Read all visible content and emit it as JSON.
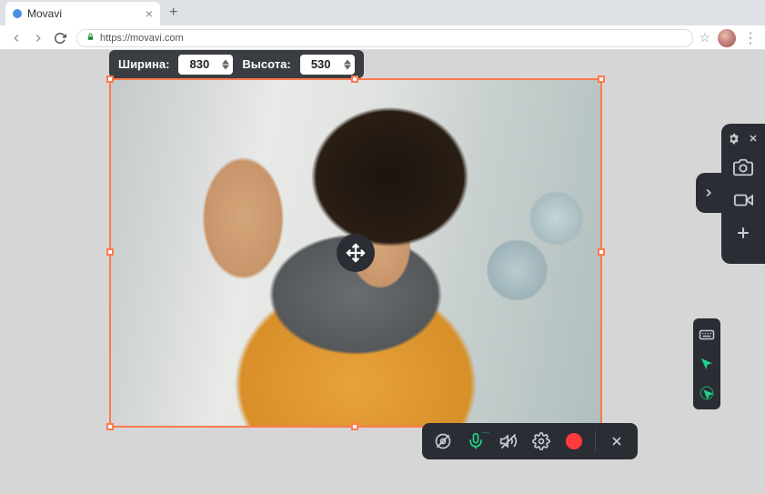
{
  "browser": {
    "tab_title": "Movavi",
    "url": "https://movavi.com"
  },
  "dimensions": {
    "width_label": "Ширина:",
    "width_value": "830",
    "height_label": "Высота:",
    "height_value": "530"
  },
  "controls": {
    "webcam": "webcam-off",
    "mic": "mic-on",
    "sound": "sound-off",
    "settings": "settings",
    "record": "record",
    "close": "close"
  },
  "side_panel": {
    "settings": "gear",
    "close": "close",
    "camera": "camera",
    "video": "video",
    "add": "plus",
    "expand": "chevron"
  },
  "vert_bar": {
    "keyboard": "keyboard",
    "cursor": "cursor-highlight",
    "click": "click-highlight"
  },
  "colors": {
    "accent": "#ff7a4d",
    "active": "#1dd68c",
    "record": "#ff3b3b"
  }
}
